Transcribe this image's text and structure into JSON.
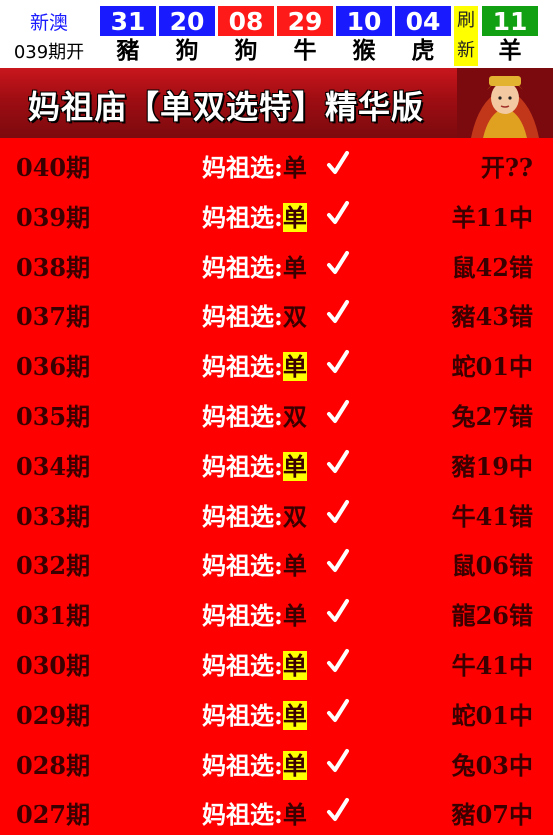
{
  "draw": {
    "region": "新澳",
    "issue": "039期开",
    "balls": [
      {
        "number": "31",
        "zodiac": "豬",
        "color": "#1a1aff"
      },
      {
        "number": "20",
        "zodiac": "狗",
        "color": "#1a1aff"
      },
      {
        "number": "08",
        "zodiac": "狗",
        "color": "#ff1a1a"
      },
      {
        "number": "29",
        "zodiac": "牛",
        "color": "#ff1a1a"
      },
      {
        "number": "10",
        "zodiac": "猴",
        "color": "#1a1aff"
      },
      {
        "number": "04",
        "zodiac": "虎",
        "color": "#1a1aff"
      }
    ],
    "refresh": [
      "刷",
      "新"
    ],
    "special": {
      "number": "11",
      "zodiac": "羊",
      "color": "#11a011"
    }
  },
  "banner": {
    "title": "妈祖庙【单双选特】精华版"
  },
  "records": [
    {
      "period": "040期",
      "label": "妈祖选:",
      "pick": "单",
      "highlight": false,
      "result": "开??"
    },
    {
      "period": "039期",
      "label": "妈祖选:",
      "pick": "单",
      "highlight": true,
      "result": "羊11中"
    },
    {
      "period": "038期",
      "label": "妈祖选:",
      "pick": "单",
      "highlight": false,
      "result": "鼠42错"
    },
    {
      "period": "037期",
      "label": "妈祖选:",
      "pick": "双",
      "highlight": false,
      "result": "豬43错"
    },
    {
      "period": "036期",
      "label": "妈祖选:",
      "pick": "单",
      "highlight": true,
      "result": "蛇01中"
    },
    {
      "period": "035期",
      "label": "妈祖选:",
      "pick": "双",
      "highlight": false,
      "result": "兔27错"
    },
    {
      "period": "034期",
      "label": "妈祖选:",
      "pick": "单",
      "highlight": true,
      "result": "豬19中"
    },
    {
      "period": "033期",
      "label": "妈祖选:",
      "pick": "双",
      "highlight": false,
      "result": "牛41错"
    },
    {
      "period": "032期",
      "label": "妈祖选:",
      "pick": "单",
      "highlight": false,
      "result": "鼠06错"
    },
    {
      "period": "031期",
      "label": "妈祖选:",
      "pick": "单",
      "highlight": false,
      "result": "龍26错"
    },
    {
      "period": "030期",
      "label": "妈祖选:",
      "pick": "单",
      "highlight": true,
      "result": "牛41中"
    },
    {
      "period": "029期",
      "label": "妈祖选:",
      "pick": "单",
      "highlight": true,
      "result": "蛇01中"
    },
    {
      "period": "028期",
      "label": "妈祖选:",
      "pick": "单",
      "highlight": true,
      "result": "兔03中"
    },
    {
      "period": "027期",
      "label": "妈祖选:",
      "pick": "单",
      "highlight": false,
      "result": "豬07中"
    }
  ],
  "icons": {
    "check": "checkmark-icon",
    "figure": "goddess-figure-image"
  },
  "colors": {
    "page_bg": "#ff0000",
    "highlight": "#ffff00",
    "dark_text": "#3a0000"
  }
}
